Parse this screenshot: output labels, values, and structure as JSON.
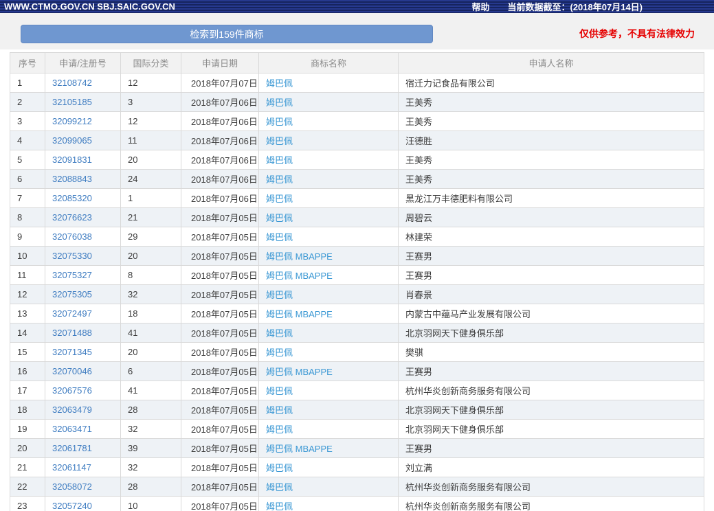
{
  "topbar": {
    "site_title": "WWW.CTMO.GOV.CN SBJ.SAIC.GOV.CN",
    "help_label": "帮助",
    "data_cutoff": "当前数据截至：(2018年07月14日)"
  },
  "banner": {
    "result_count_label": "检索到159件商标",
    "disclaimer": "仅供参考，不具有法律效力"
  },
  "table": {
    "headers": [
      "序号",
      "申请/注册号",
      "国际分类",
      "申请日期",
      "商标名称",
      "申请人名称"
    ],
    "rows": [
      {
        "no": "1",
        "reg_no": "32108742",
        "intl_class": "12",
        "app_date": "2018年07月07日",
        "trademark": "姆巴佩",
        "applicant": "宿迁力记食品有限公司"
      },
      {
        "no": "2",
        "reg_no": "32105185",
        "intl_class": "3",
        "app_date": "2018年07月06日",
        "trademark": "姆巴佩",
        "applicant": "王美秀"
      },
      {
        "no": "3",
        "reg_no": "32099212",
        "intl_class": "12",
        "app_date": "2018年07月06日",
        "trademark": "姆巴佩",
        "applicant": "王美秀"
      },
      {
        "no": "4",
        "reg_no": "32099065",
        "intl_class": "11",
        "app_date": "2018年07月06日",
        "trademark": "姆巴佩",
        "applicant": "汪德胜"
      },
      {
        "no": "5",
        "reg_no": "32091831",
        "intl_class": "20",
        "app_date": "2018年07月06日",
        "trademark": "姆巴佩",
        "applicant": "王美秀"
      },
      {
        "no": "6",
        "reg_no": "32088843",
        "intl_class": "24",
        "app_date": "2018年07月06日",
        "trademark": "姆巴佩",
        "applicant": "王美秀"
      },
      {
        "no": "7",
        "reg_no": "32085320",
        "intl_class": "1",
        "app_date": "2018年07月06日",
        "trademark": "姆巴佩",
        "applicant": "黑龙江万丰德肥料有限公司"
      },
      {
        "no": "8",
        "reg_no": "32076623",
        "intl_class": "21",
        "app_date": "2018年07月05日",
        "trademark": "姆巴佩",
        "applicant": "周碧云"
      },
      {
        "no": "9",
        "reg_no": "32076038",
        "intl_class": "29",
        "app_date": "2018年07月05日",
        "trademark": "姆巴佩",
        "applicant": "林建荣"
      },
      {
        "no": "10",
        "reg_no": "32075330",
        "intl_class": "20",
        "app_date": "2018年07月05日",
        "trademark": "姆巴佩 MBAPPE",
        "applicant": "王赛男"
      },
      {
        "no": "11",
        "reg_no": "32075327",
        "intl_class": "8",
        "app_date": "2018年07月05日",
        "trademark": "姆巴佩 MBAPPE",
        "applicant": "王赛男"
      },
      {
        "no": "12",
        "reg_no": "32075305",
        "intl_class": "32",
        "app_date": "2018年07月05日",
        "trademark": "姆巴佩",
        "applicant": "肖春景"
      },
      {
        "no": "13",
        "reg_no": "32072497",
        "intl_class": "18",
        "app_date": "2018年07月05日",
        "trademark": "姆巴佩 MBAPPE",
        "applicant": "内蒙古中蕴马产业发展有限公司"
      },
      {
        "no": "14",
        "reg_no": "32071488",
        "intl_class": "41",
        "app_date": "2018年07月05日",
        "trademark": "姆巴佩",
        "applicant": "北京羽网天下健身俱乐部"
      },
      {
        "no": "15",
        "reg_no": "32071345",
        "intl_class": "20",
        "app_date": "2018年07月05日",
        "trademark": "姆巴佩",
        "applicant": "樊骐"
      },
      {
        "no": "16",
        "reg_no": "32070046",
        "intl_class": "6",
        "app_date": "2018年07月05日",
        "trademark": "姆巴佩 MBAPPE",
        "applicant": "王赛男"
      },
      {
        "no": "17",
        "reg_no": "32067576",
        "intl_class": "41",
        "app_date": "2018年07月05日",
        "trademark": "姆巴佩",
        "applicant": "杭州华炎创新商务服务有限公司"
      },
      {
        "no": "18",
        "reg_no": "32063479",
        "intl_class": "28",
        "app_date": "2018年07月05日",
        "trademark": "姆巴佩",
        "applicant": "北京羽网天下健身俱乐部"
      },
      {
        "no": "19",
        "reg_no": "32063471",
        "intl_class": "32",
        "app_date": "2018年07月05日",
        "trademark": "姆巴佩",
        "applicant": "北京羽网天下健身俱乐部"
      },
      {
        "no": "20",
        "reg_no": "32061781",
        "intl_class": "39",
        "app_date": "2018年07月05日",
        "trademark": "姆巴佩 MBAPPE",
        "applicant": "王赛男"
      },
      {
        "no": "21",
        "reg_no": "32061147",
        "intl_class": "32",
        "app_date": "2018年07月05日",
        "trademark": "姆巴佩",
        "applicant": "刘立满"
      },
      {
        "no": "22",
        "reg_no": "32058072",
        "intl_class": "28",
        "app_date": "2018年07月05日",
        "trademark": "姆巴佩",
        "applicant": "杭州华炎创新商务服务有限公司"
      },
      {
        "no": "23",
        "reg_no": "32057240",
        "intl_class": "10",
        "app_date": "2018年07月05日",
        "trademark": "姆巴佩",
        "applicant": "杭州华炎创新商务服务有限公司"
      }
    ]
  },
  "colors": {
    "topbar_navy": "#1c2c77",
    "button_blue": "#6f97d0",
    "disclaimer_red": "#e60000",
    "reg_link_blue": "#3e7cc1",
    "trademark_link_blue": "#3b98d4",
    "even_row_bg": "#eef2f6",
    "header_row_bg": "#f2f2f2"
  }
}
